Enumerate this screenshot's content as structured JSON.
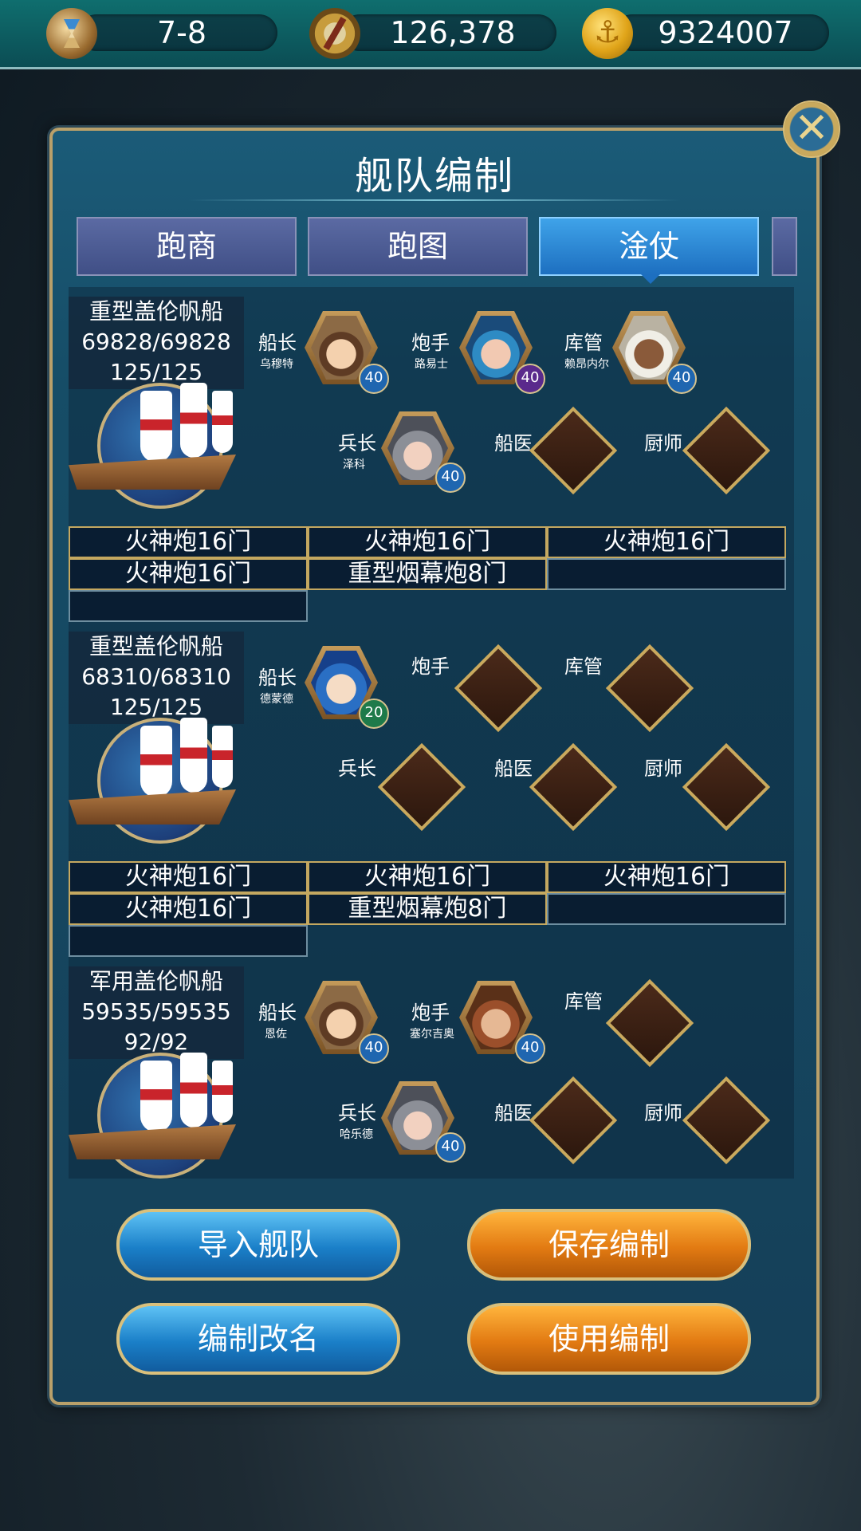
{
  "topbar": {
    "stage": "7-8",
    "fame": "126,378",
    "gold": "9324007",
    "icons": [
      "hourglass-icon",
      "compass-icon",
      "gold-coin-icon"
    ]
  },
  "panel": {
    "title": "舰队编制",
    "close_icon": "close-icon"
  },
  "tabs": [
    {
      "label": "跑商",
      "active": false
    },
    {
      "label": "跑图",
      "active": false
    },
    {
      "label": "淦仗",
      "active": true
    }
  ],
  "ships": [
    {
      "name": "重型盖伦帆船",
      "hp": "69828/69828",
      "crew_count": "125/125",
      "roles": {
        "captain": {
          "role": "船长",
          "name": "乌穆特",
          "level": "40"
        },
        "gunner": {
          "role": "炮手",
          "name": "路易士",
          "level": "40"
        },
        "quartermaster": {
          "role": "库管",
          "name": "赖昂内尔",
          "level": "40"
        },
        "soldier": {
          "role": "兵长",
          "name": "泽科",
          "level": "40"
        },
        "doctor": {
          "role": "船医"
        },
        "cook": {
          "role": "厨师"
        }
      },
      "weapons": [
        "火神炮16门",
        "火神炮16门",
        "火神炮16门",
        "火神炮16门",
        "重型烟幕炮8门",
        "",
        ""
      ]
    },
    {
      "name": "重型盖伦帆船",
      "hp": "68310/68310",
      "crew_count": "125/125",
      "roles": {
        "captain": {
          "role": "船长",
          "name": "德蒙德",
          "level": "20"
        },
        "gunner": {
          "role": "炮手"
        },
        "quartermaster": {
          "role": "库管"
        },
        "soldier": {
          "role": "兵长"
        },
        "doctor": {
          "role": "船医"
        },
        "cook": {
          "role": "厨师"
        }
      },
      "weapons": [
        "火神炮16门",
        "火神炮16门",
        "火神炮16门",
        "火神炮16门",
        "重型烟幕炮8门",
        "",
        ""
      ]
    },
    {
      "name": "军用盖伦帆船",
      "hp": "59535/59535",
      "crew_count": "92/92",
      "roles": {
        "captain": {
          "role": "船长",
          "name": "恩佐",
          "level": "40"
        },
        "gunner": {
          "role": "炮手",
          "name": "塞尔吉奥",
          "level": "40"
        },
        "quartermaster": {
          "role": "库管"
        },
        "soldier": {
          "role": "兵长",
          "name": "哈乐德",
          "level": "40"
        },
        "doctor": {
          "role": "船医"
        },
        "cook": {
          "role": "厨师"
        }
      }
    }
  ],
  "buttons": {
    "import": "导入舰队",
    "save": "保存编制",
    "rename": "编制改名",
    "use": "使用编制"
  },
  "colors": {
    "panel": "#164d67",
    "tab_active": "#1d6fc0",
    "button_blue": "#1a7fc8",
    "button_orange": "#e27a12",
    "gold_border": "#c4a860"
  }
}
